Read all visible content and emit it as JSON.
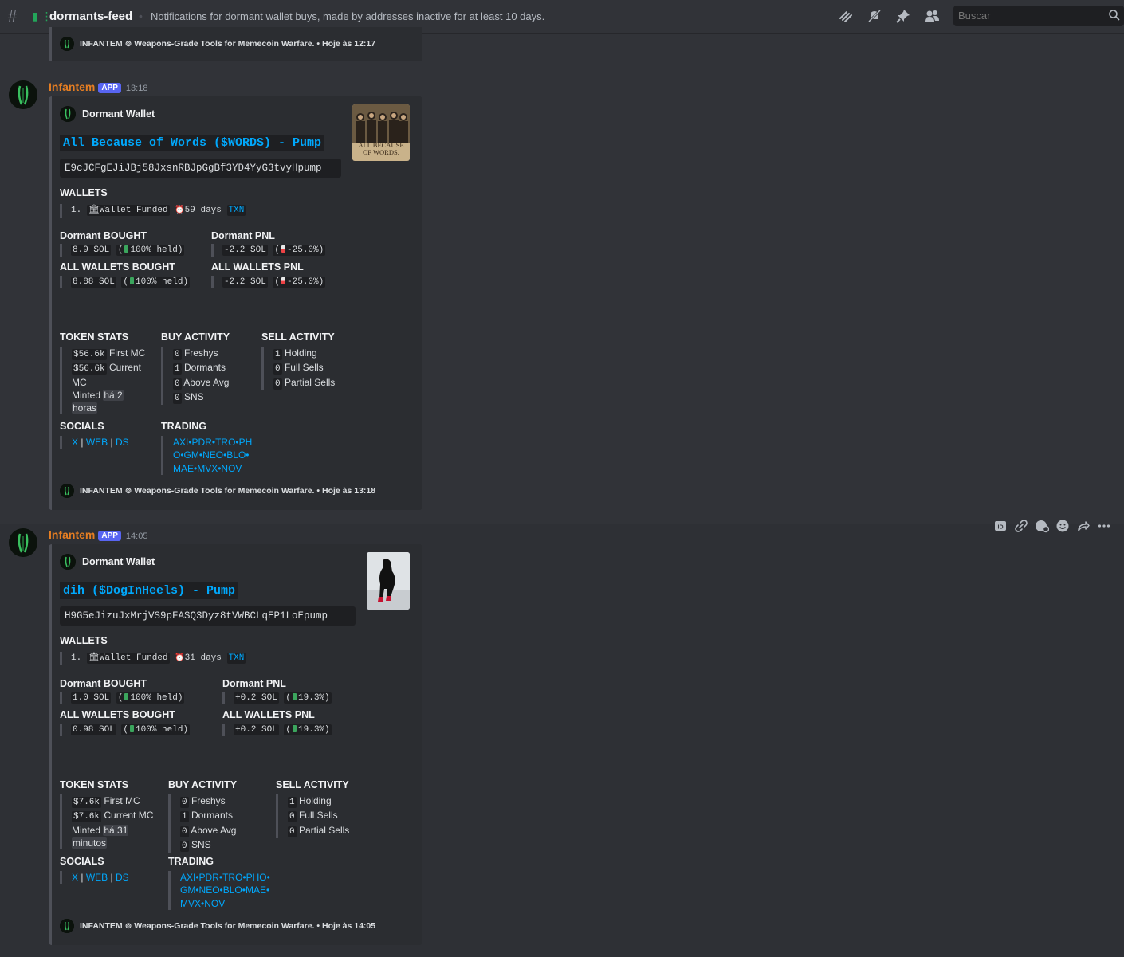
{
  "header": {
    "channel_name": "dormants-feed",
    "topic": "Notifications for dormant wallet buys, made by addresses inactive for at least 10 days.",
    "search_placeholder": "Buscar",
    "icons": [
      "threads-icon",
      "mute-bell-icon",
      "pin-icon",
      "members-icon",
      "search-icon"
    ]
  },
  "prev_footer": {
    "text": "INFANTEM ⊚ Weapons-Grade Tools for Memecoin Warfare. • Hoje às 12:17"
  },
  "messages": [
    {
      "author": "Infantem",
      "badge": "APP",
      "time": "13:18",
      "embed": {
        "author": "Dormant Wallet",
        "title": "All Because of Words ($WORDS) - Pump",
        "mint": "E9cJCFgEJiJBj58JxsnRBJpGgBf3YD4YyG3tvyHpump",
        "thumb_text": "ALL BECAUSE OF WORDS.",
        "wallets_label": "WALLETS",
        "wallet_row": {
          "index": "1.",
          "wallet": "Wallet Funded",
          "days": "59 days",
          "txn": "TXN"
        },
        "dormant_bought_label": "Dormant BOUGHT",
        "dormant_bought": {
          "amount": "8.9 SOL",
          "pct": "100% held"
        },
        "dormant_pnl_label": "Dormant PNL",
        "dormant_pnl": {
          "amount": "-2.2 SOL",
          "pct": "-25.0%"
        },
        "all_bought_label": "ALL WALLETS BOUGHT",
        "all_bought": {
          "amount": "8.88 SOL",
          "pct": "100% held"
        },
        "all_pnl_label": "ALL WALLETS PNL",
        "all_pnl": {
          "amount": "-2.2 SOL",
          "pct": "-25.0%"
        },
        "token_stats_label": "TOKEN STATS",
        "token_stats": {
          "first_mc_val": "$56.6k",
          "first_mc": "First MC",
          "current_mc_val": "$56.6k",
          "current_mc_a": "Current",
          "current_mc_b": "MC",
          "minted": "Minted",
          "minted_ago_a": "há 2",
          "minted_ago_b": "horas"
        },
        "buy_label": "BUY ACTIVITY",
        "buy": [
          {
            "n": "0",
            "t": "Freshys"
          },
          {
            "n": "1",
            "t": "Dormants"
          },
          {
            "n": "0",
            "t": "Above Avg"
          },
          {
            "n": "0",
            "t": "SNS"
          }
        ],
        "sell_label": "SELL ACTIVITY",
        "sell": [
          {
            "n": "1",
            "t": "Holding"
          },
          {
            "n": "0",
            "t": "Full Sells"
          },
          {
            "n": "0",
            "t": "Partial Sells"
          }
        ],
        "socials_label": "SOCIALS",
        "socials": [
          "X",
          "WEB",
          "DS"
        ],
        "trading_label": "TRADING",
        "trading_lines": [
          "AXI•PDR•TRO•PH",
          "O•GM•NEO•BLO•",
          "MAE•MVX•NOV"
        ],
        "footer": "INFANTEM ⊚ Weapons-Grade Tools for Memecoin Warfare. • Hoje às 13:18"
      }
    },
    {
      "author": "Infantem",
      "badge": "APP",
      "time": "14:05",
      "embed": {
        "author": "Dormant Wallet",
        "title": "dih ($DogInHeels) - Pump",
        "mint": "H9G5eJizuJxMrjVS9pFASQ3Dyz8tVWBCLqEP1LoEpump",
        "wallets_label": "WALLETS",
        "wallet_row": {
          "index": "1.",
          "wallet": "Wallet Funded",
          "days": "31 days",
          "txn": "TXN"
        },
        "dormant_bought_label": "Dormant BOUGHT",
        "dormant_bought": {
          "amount": "1.0 SOL",
          "pct": "100% held"
        },
        "dormant_pnl_label": "Dormant PNL",
        "dormant_pnl": {
          "amount": "+0.2 SOL",
          "pct": "19.3%"
        },
        "all_bought_label": "ALL WALLETS BOUGHT",
        "all_bought": {
          "amount": "0.98 SOL",
          "pct": "100% held"
        },
        "all_pnl_label": "ALL WALLETS PNL",
        "all_pnl": {
          "amount": "+0.2 SOL",
          "pct": "19.3%"
        },
        "token_stats_label": "TOKEN STATS",
        "token_stats": {
          "first_mc_val": "$7.6k",
          "first_mc": "First MC",
          "current_mc_val": "$7.6k",
          "current_mc": "Current MC",
          "minted": "Minted",
          "minted_ago_a": "há 31",
          "minted_ago_b": "minutos"
        },
        "buy_label": "BUY ACTIVITY",
        "buy": [
          {
            "n": "0",
            "t": "Freshys"
          },
          {
            "n": "1",
            "t": "Dormants"
          },
          {
            "n": "0",
            "t": "Above Avg"
          },
          {
            "n": "0",
            "t": "SNS"
          }
        ],
        "sell_label": "SELL ACTIVITY",
        "sell": [
          {
            "n": "1",
            "t": "Holding"
          },
          {
            "n": "0",
            "t": "Full Sells"
          },
          {
            "n": "0",
            "t": "Partial Sells"
          }
        ],
        "socials_label": "SOCIALS",
        "socials": [
          "X",
          "WEB",
          "DS"
        ],
        "trading_label": "TRADING",
        "trading_lines": [
          "AXI•PDR•TRO•PHO•",
          "GM•NEO•BLO•MAE•",
          "MVX•NOV"
        ],
        "footer": "INFANTEM ⊚ Weapons-Grade Tools for Memecoin Warfare. • Hoje às 14:05"
      }
    }
  ],
  "action_bar": [
    "app-id-icon",
    "copy-link-icon",
    "add-reaction-super-icon",
    "add-reaction-icon",
    "forward-icon",
    "more-icon"
  ]
}
